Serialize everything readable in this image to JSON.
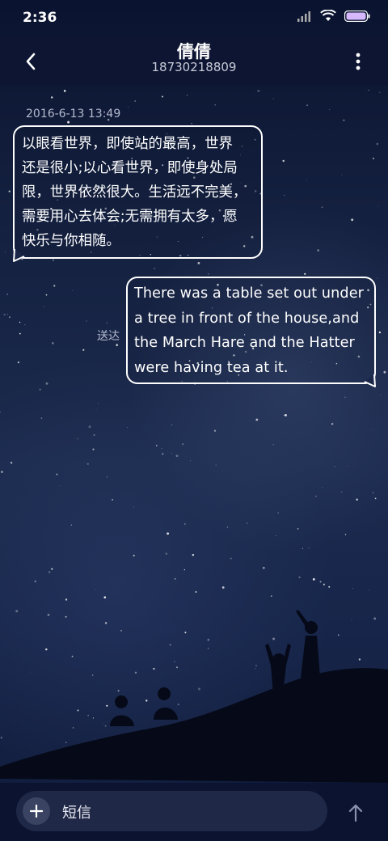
{
  "status_bar": {
    "time": "2:36",
    "icons": [
      "signal-icon",
      "wifi-icon",
      "battery-icon"
    ]
  },
  "header": {
    "contact_name": "倩倩",
    "phone_number": "18730218809",
    "back_icon": "chevron-left-icon",
    "more_icon": "more-vertical-icon"
  },
  "conversation": {
    "timestamp": "2016-6-13 13:49",
    "received_message": "以眼看世界，即使站的最高，世界\n还是很小;以心看世界，即使身处局\n限，世界依然很大。生活远不完美，\n需要用心去体会;无需拥有太多，愿\n快乐与你相随。",
    "sent_message": "There was a table set out under\na tree in front of the house,and\nthe March Hare and the Hatter\nwere having tea at it.",
    "sent_status": "送达"
  },
  "composer": {
    "placeholder": "短信",
    "add_icon": "plus-icon",
    "send_icon": "arrow-up-icon"
  },
  "colors": {
    "header_bg": "#0d1533",
    "input_bg": "#1f2847",
    "bubble_border": "#ffffff"
  }
}
